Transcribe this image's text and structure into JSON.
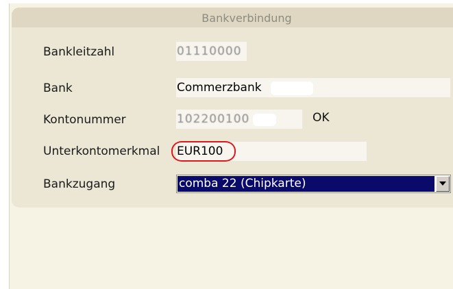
{
  "panel": {
    "title": "Bankverbindung"
  },
  "form": {
    "bankleitzahl": {
      "label": "Bankleitzahl",
      "value": "01110000"
    },
    "bank": {
      "label": "Bank",
      "value": "Commerzbank"
    },
    "kontonummer": {
      "label": "Kontonummer",
      "value": "102200100",
      "status": "OK"
    },
    "unterkonto": {
      "label": "Unterkontomerkmal",
      "value": "EUR100"
    },
    "bankzugang": {
      "label": "Bankzugang",
      "selected": "comba 22 (Chipkarte)"
    }
  },
  "icons": {
    "dropdown": "chevron-down-icon"
  },
  "colors": {
    "highlight_circle": "#e3141b",
    "selection_background": "#0a0a6b",
    "panel_background": "#ece6d4"
  }
}
